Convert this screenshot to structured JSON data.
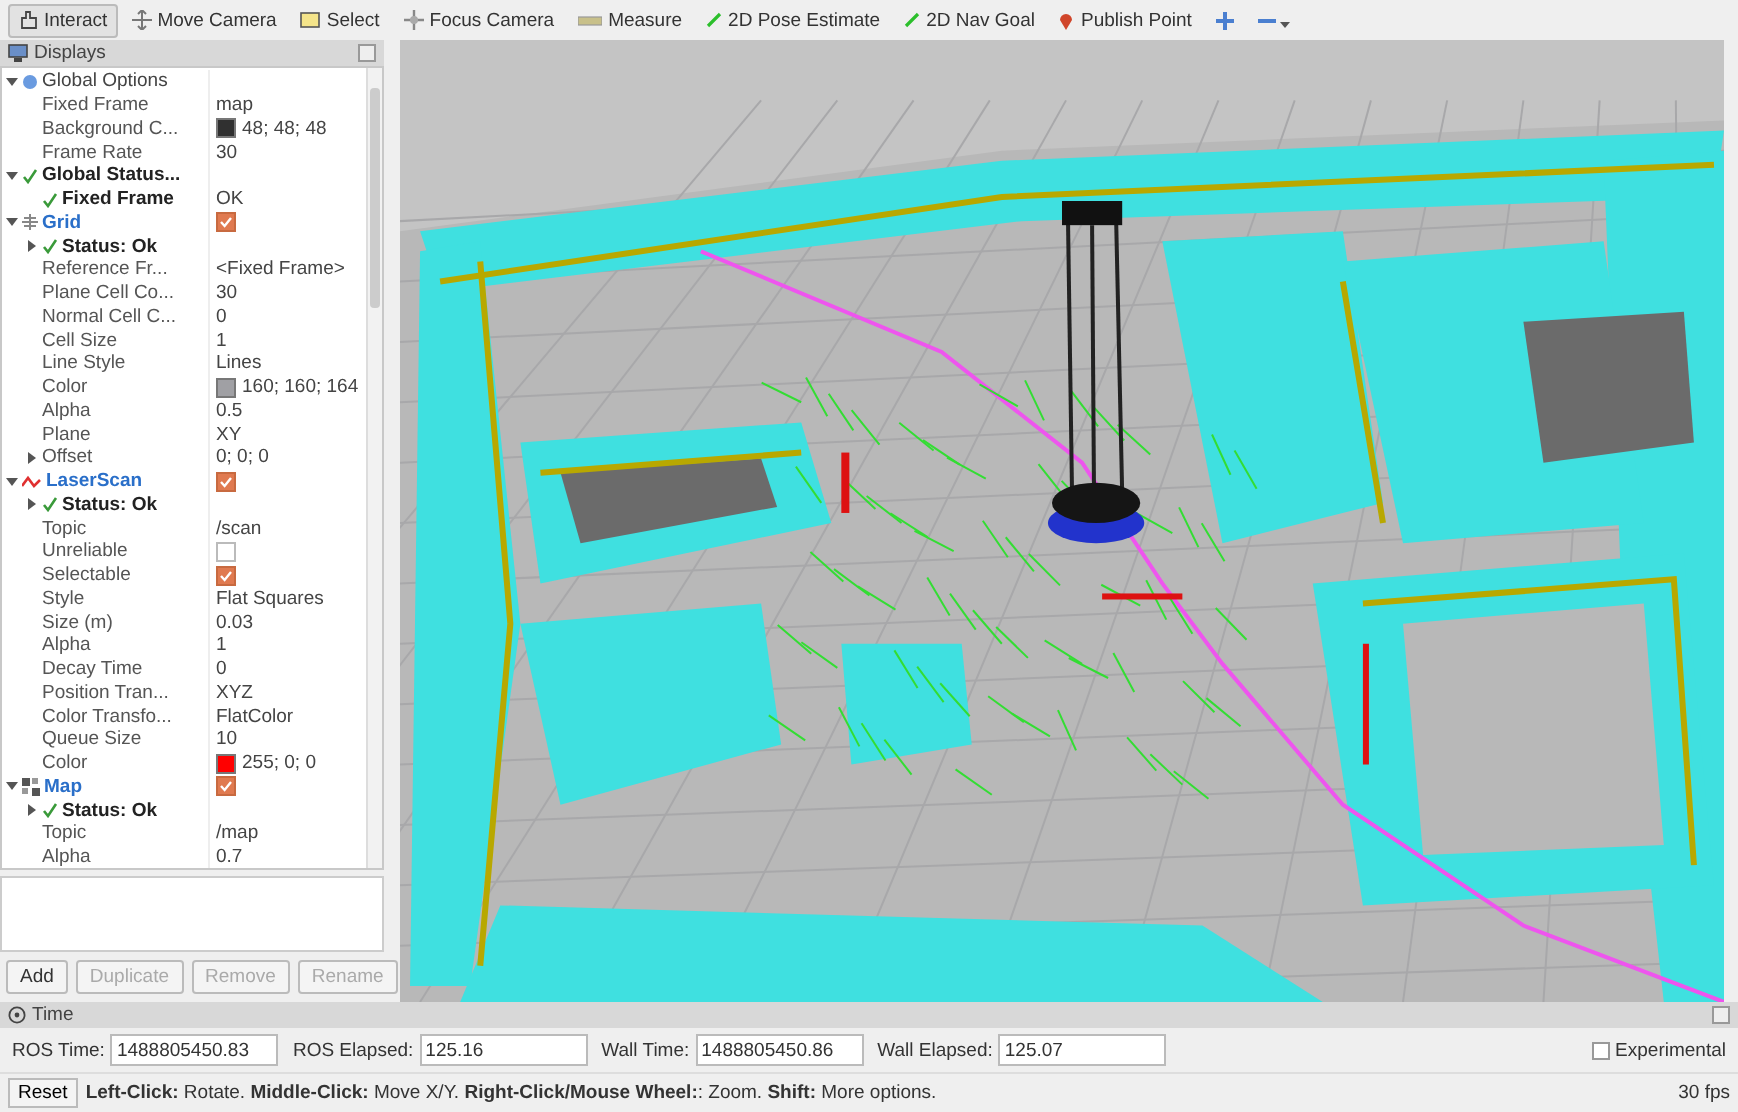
{
  "toolbar": {
    "tools": [
      {
        "kind": "interact",
        "label": "Interact",
        "selected": true
      },
      {
        "kind": "move_camera",
        "label": "Move Camera",
        "selected": false
      },
      {
        "kind": "select",
        "label": "Select",
        "selected": false
      },
      {
        "kind": "focus_camera",
        "label": "Focus Camera",
        "selected": false
      },
      {
        "kind": "measure",
        "label": "Measure",
        "selected": false
      },
      {
        "kind": "pose_estimate",
        "label": "2D Pose Estimate",
        "selected": false
      },
      {
        "kind": "nav_goal",
        "label": "2D Nav Goal",
        "selected": false
      },
      {
        "kind": "publish_point",
        "label": "Publish Point",
        "selected": false
      }
    ]
  },
  "displays_panel": {
    "title": "Displays",
    "tree": [
      {
        "kind": "options",
        "name": "Global Options",
        "expanded": true,
        "children": [
          {
            "kind": "property",
            "name": "Fixed Frame",
            "value": "map"
          },
          {
            "kind": "property",
            "name": "Background C...",
            "value": "48; 48; 48",
            "color": "#303030"
          },
          {
            "kind": "property",
            "name": "Frame Rate",
            "value": "30"
          }
        ]
      },
      {
        "kind": "status",
        "name": "Global Status...",
        "expanded": true,
        "children": [
          {
            "kind": "status",
            "name": "Fixed Frame",
            "value": "OK"
          }
        ]
      },
      {
        "kind": "grid",
        "name": "Grid",
        "expanded": true,
        "checked": true,
        "children": [
          {
            "kind": "status",
            "name": "Status: Ok",
            "expanded": false
          },
          {
            "kind": "property",
            "name": "Reference Fr...",
            "value": "<Fixed Frame>"
          },
          {
            "kind": "property",
            "name": "Plane Cell Co...",
            "value": "30"
          },
          {
            "kind": "property",
            "name": "Normal Cell C...",
            "value": "0"
          },
          {
            "kind": "property",
            "name": "Cell Size",
            "value": "1"
          },
          {
            "kind": "property",
            "name": "Line Style",
            "value": "Lines"
          },
          {
            "kind": "property",
            "name": "Color",
            "value": "160; 160; 164",
            "color": "#a0a0a4"
          },
          {
            "kind": "property",
            "name": "Alpha",
            "value": "0.5"
          },
          {
            "kind": "property",
            "name": "Plane",
            "value": "XY"
          },
          {
            "kind": "property",
            "name": "Offset",
            "value": "0; 0; 0",
            "expanded": false
          }
        ]
      },
      {
        "kind": "laser_scan",
        "name": "LaserScan",
        "expanded": true,
        "checked": true,
        "children": [
          {
            "kind": "status",
            "name": "Status: Ok",
            "expanded": false
          },
          {
            "kind": "property",
            "name": "Topic",
            "value": "/scan"
          },
          {
            "kind": "property",
            "name": "Unreliable",
            "checked": false
          },
          {
            "kind": "property",
            "name": "Selectable",
            "checked": true
          },
          {
            "kind": "property",
            "name": "Style",
            "value": "Flat Squares"
          },
          {
            "kind": "property",
            "name": "Size (m)",
            "value": "0.03"
          },
          {
            "kind": "property",
            "name": "Alpha",
            "value": "1"
          },
          {
            "kind": "property",
            "name": "Decay Time",
            "value": "0"
          },
          {
            "kind": "property",
            "name": "Position Tran...",
            "value": "XYZ"
          },
          {
            "kind": "property",
            "name": "Color Transfo...",
            "value": "FlatColor"
          },
          {
            "kind": "property",
            "name": "Queue Size",
            "value": "10"
          },
          {
            "kind": "property",
            "name": "Color",
            "value": "255; 0; 0",
            "color": "#ff0000"
          }
        ]
      },
      {
        "kind": "map",
        "name": "Map",
        "expanded": true,
        "checked": true,
        "children": [
          {
            "kind": "status",
            "name": "Status: Ok",
            "expanded": false
          },
          {
            "kind": "property",
            "name": "Topic",
            "value": "/map"
          },
          {
            "kind": "property",
            "name": "Alpha",
            "value": "0.7"
          }
        ]
      }
    ],
    "buttons": [
      {
        "label": "Add",
        "disabled": false
      },
      {
        "label": "Duplicate",
        "disabled": true
      },
      {
        "label": "Remove",
        "disabled": true
      },
      {
        "label": "Rename",
        "disabled": true
      }
    ]
  },
  "time_panel": {
    "title": "Time",
    "fields": [
      {
        "label": "ROS Time:",
        "value": "1488805450.83"
      },
      {
        "label": "ROS Elapsed:",
        "value": "125.16"
      },
      {
        "label": "Wall Time:",
        "value": "1488805450.86"
      },
      {
        "label": "Wall Elapsed:",
        "value": "125.07"
      }
    ],
    "experimental": {
      "label": "Experimental",
      "checked": false
    }
  },
  "status_bar": {
    "reset_button": "Reset",
    "hint": "**Left-Click:** Rotate. **Middle-Click:** Move X/Y. **Right-Click/Mouse Wheel:**: Zoom. **Shift:** More options.",
    "fps": "30 fps"
  }
}
